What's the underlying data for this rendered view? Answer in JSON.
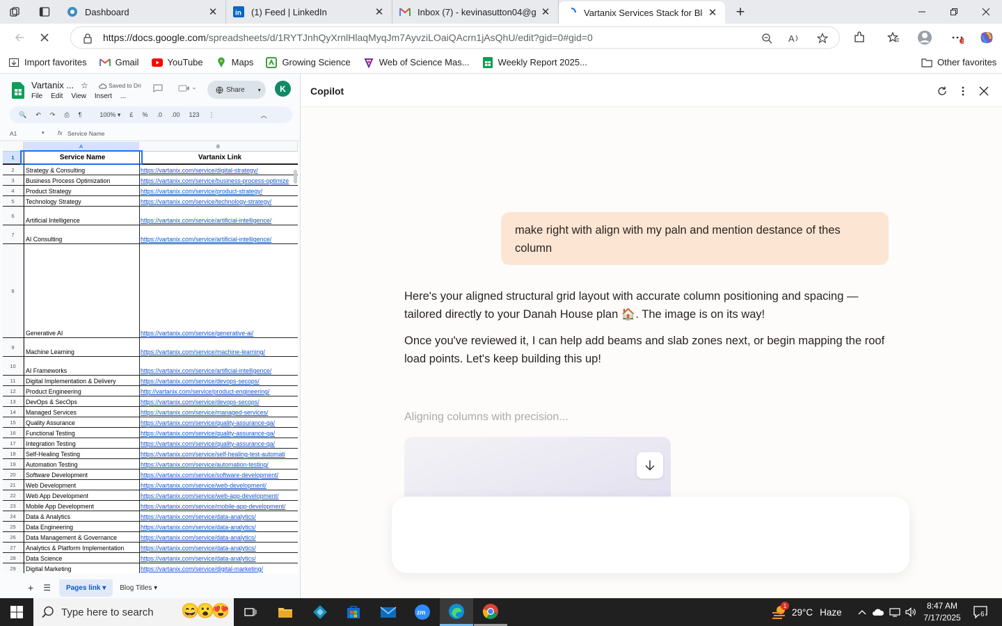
{
  "tabs": [
    {
      "title": "Dashboard"
    },
    {
      "title": "(1) Feed | LinkedIn"
    },
    {
      "title": "Inbox (7) - kevinasutton04@gmai"
    },
    {
      "title": "Vartanix Services Stack for Blog C"
    }
  ],
  "address": {
    "url_host": "https://docs.google.com",
    "url_path": "/spreadsheets/d/1RYTJnhQyXrnlHlaqMyqJm7AyvziLOaiQAcrn1jAsQhU/edit?gid=0#gid=0"
  },
  "favorites": [
    "Import favorites",
    "Gmail",
    "YouTube",
    "Maps",
    "Growing Science",
    "Web of Science Mas...",
    "Weekly Report 2025..."
  ],
  "other_favorites": "Other favorites",
  "sheet": {
    "title": "Vartanix ...",
    "saved": "Saved to Dri",
    "share": "Share",
    "avatar": "K",
    "menus": [
      "File",
      "Edit",
      "View",
      "Insert"
    ],
    "zoom": "100%",
    "fmt": [
      "£",
      "%",
      ".0",
      ".00",
      "123"
    ],
    "cell_ref": "A1",
    "formula": "Service Name",
    "col_a": "A",
    "col_b": "B",
    "header_a": "Service Name",
    "header_b": "Vartanix Link",
    "rows": [
      {
        "n": "2",
        "a": "Strategy & Consulting",
        "b": "https://vartanix.com/service/digital-strategy/"
      },
      {
        "n": "3",
        "a": "Business Process Optimization",
        "b": "https://vartanix.com/service/business-process-optimize"
      },
      {
        "n": "4",
        "a": "Product Strategy",
        "b": "https://vartanix.com/service/product-strategy/"
      },
      {
        "n": "5",
        "a": "Technology Strategy",
        "b": "https://vartanix.com/service/technology-strategy/"
      },
      {
        "n": "6",
        "a": "Artificial Intelligence",
        "b": "https://vartanix.com/service/artificial-intelligence/"
      },
      {
        "n": "7",
        "a": "AI Consulting",
        "b": "https://vartanix.com/service/artificial-intelligence/"
      },
      {
        "n": "8",
        "a": "Generative AI",
        "b": "https://vartanix.com/service/generative-ai/"
      },
      {
        "n": "9",
        "a": "Machine Learning",
        "b": "https://vartanix.com/service/machine-learning/"
      },
      {
        "n": "10",
        "a": "AI Frameworks",
        "b": "https://vartanix.com/service/artificial-intelligence/"
      },
      {
        "n": "11",
        "a": "Digital Implementation & Delivery",
        "b": "https://vartanix.com/service/devops-secops/"
      },
      {
        "n": "12",
        "a": "Product Engineering",
        "b": "http://vartanix.com/service/product-engineering/"
      },
      {
        "n": "13",
        "a": "DevOps & SecOps",
        "b": "https://vartanix.com/service/devops-secops/"
      },
      {
        "n": "14",
        "a": "Managed Services",
        "b": "https://vartanix.com/service/managed-services/"
      },
      {
        "n": "15",
        "a": "Quality Assurance",
        "b": "https://vartanix.com/service/quality-assurance-qa/"
      },
      {
        "n": "16",
        "a": "Functional Testing",
        "b": "https://vartanix.com/service/quality-assurance-qa/"
      },
      {
        "n": "17",
        "a": "Integration Testing",
        "b": "https://vartanix.com/service/quality-assurance-qa/"
      },
      {
        "n": "18",
        "a": "Self-Healing Testing",
        "b": "https://vartanix.com/service/self-healing-test-automati"
      },
      {
        "n": "19",
        "a": "Automation Testing",
        "b": "https://vartanix.com/service/automation-testing/"
      },
      {
        "n": "20",
        "a": "Software Development",
        "b": "https://vartanix.com/service/software-development/"
      },
      {
        "n": "21",
        "a": "Web Development",
        "b": "https://vartanix.com/service/web-development/"
      },
      {
        "n": "22",
        "a": "Web App Development",
        "b": "https://vartanix.com/service/web-app-development/"
      },
      {
        "n": "23",
        "a": "Mobile App Development",
        "b": "https://vartanix.com/service/mobile-app-development/"
      },
      {
        "n": "24",
        "a": "Data & Analytics",
        "b": "https://vartanix.com/service/data-analytics/"
      },
      {
        "n": "25",
        "a": "Data Engineering",
        "b": "https://vartanix.com/service/data-analytics/"
      },
      {
        "n": "26",
        "a": "Data Management & Governance",
        "b": "https://vartanix.com/service/data-analytics/"
      },
      {
        "n": "27",
        "a": "Analytics & Platform Implementation",
        "b": "https://vartanix.com/service/data-analytics/"
      },
      {
        "n": "28",
        "a": "Data Science",
        "b": "https://vartanix.com/service/data-analytics/"
      },
      {
        "n": "29",
        "a": "Digital Marketing",
        "b": "https://vartanix.com/service/digital-marketing/"
      }
    ],
    "sheet_tabs": [
      "Pages link",
      "Blog Titles"
    ]
  },
  "copilot": {
    "title": "Copilot",
    "user_message": "make right with align with my paln and mention destance of thes column",
    "ai_p1": "Here's your aligned structural grid layout with accurate column positioning and spacing — tailored directly to your Danah House plan 🏠. The image is on its way!",
    "ai_p2": "Once you've reviewed it, I can help add beams and slab zones next, or begin mapping the roof load points. Let's keep building this up!",
    "working": "Aligning columns with precision..."
  },
  "taskbar": {
    "search_placeholder": "Type here to search",
    "temp": "29°C",
    "condition": "Haze",
    "time": "8:47 AM",
    "date": "7/17/2025",
    "notif_count": "6",
    "weather_badge": "1"
  },
  "colors": {
    "accent": "#0f8a65",
    "user_bubble": "#fce5d3",
    "link": "#1155cc"
  }
}
